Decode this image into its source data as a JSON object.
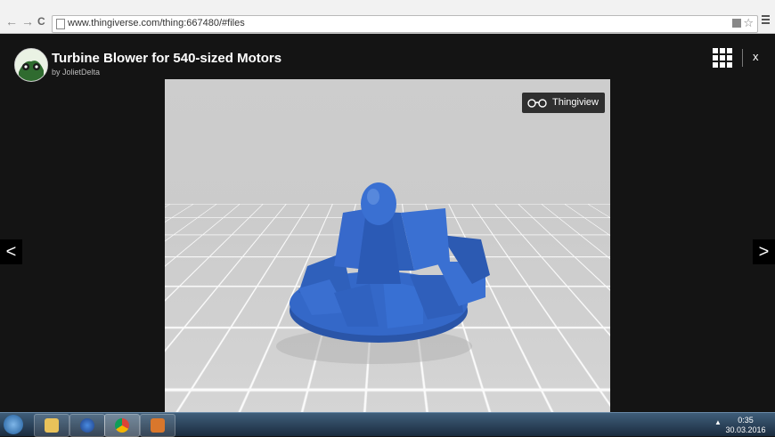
{
  "browser": {
    "url": "www.thingiverse.com/thing:667480/#files",
    "back_icon": "←",
    "forward_icon": "→",
    "reload_icon": "C",
    "star_icon": "☆"
  },
  "lightbox": {
    "title": "Turbine Blower for 540-sized Motors",
    "author": "by JolietDelta",
    "close_label": "x",
    "prev_icon": "<",
    "next_icon": ">"
  },
  "viewer": {
    "thingiview_label": "Thingiview",
    "model_color": "#2f63c4"
  },
  "taskbar": {
    "time": "0:35",
    "date": "30.03.2016",
    "tray_arrow": "▲",
    "apps": [
      "file-explorer-icon",
      "firefox-icon",
      "chrome-icon",
      "installer-icon"
    ]
  }
}
